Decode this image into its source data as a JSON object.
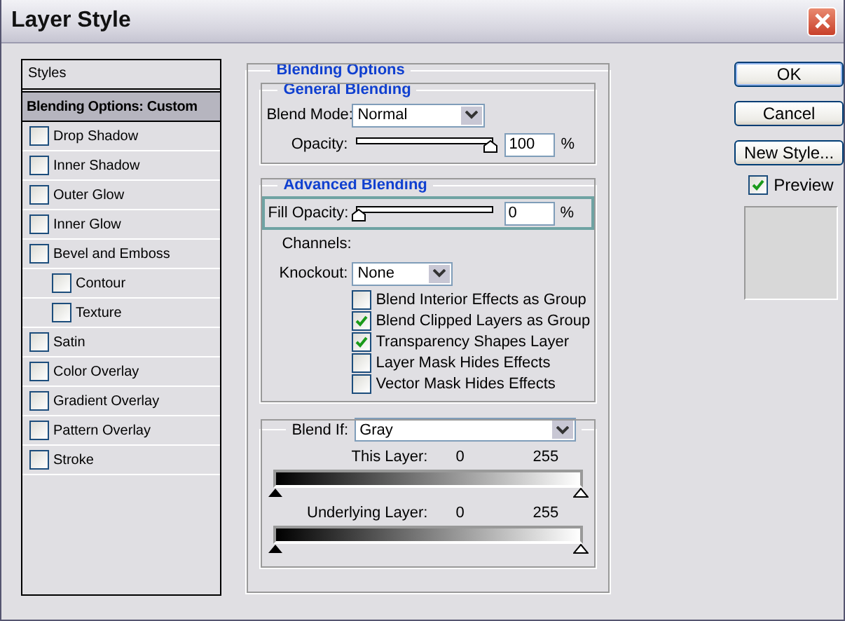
{
  "window": {
    "title": "Layer Style"
  },
  "styles_panel": {
    "header": "Styles",
    "items": [
      {
        "label": "Blending Options: Custom",
        "kind": "heading",
        "selected": true
      },
      {
        "label": "Drop Shadow",
        "kind": "check",
        "checked": false,
        "selected": false
      },
      {
        "label": "Inner Shadow",
        "kind": "check",
        "checked": false,
        "selected": false
      },
      {
        "label": "Outer Glow",
        "kind": "check",
        "checked": false,
        "selected": false
      },
      {
        "label": "Inner Glow",
        "kind": "check",
        "checked": false,
        "selected": false
      },
      {
        "label": "Bevel and Emboss",
        "kind": "check",
        "checked": false,
        "selected": false,
        "children": [
          {
            "label": "Contour",
            "kind": "check",
            "checked": false,
            "selected": false
          },
          {
            "label": "Texture",
            "kind": "check",
            "checked": false,
            "selected": false
          }
        ]
      },
      {
        "label": "Satin",
        "kind": "check",
        "checked": false,
        "selected": false
      },
      {
        "label": "Color Overlay",
        "kind": "check",
        "checked": false,
        "selected": false
      },
      {
        "label": "Gradient Overlay",
        "kind": "check",
        "checked": false,
        "selected": false
      },
      {
        "label": "Pattern Overlay",
        "kind": "check",
        "checked": false,
        "selected": false
      },
      {
        "label": "Stroke",
        "kind": "check",
        "checked": false,
        "selected": false
      }
    ]
  },
  "blending_options": {
    "title": "Blending Options",
    "general": {
      "title": "General Blending",
      "blend_mode": {
        "label": "Blend Mode:",
        "value": "Normal"
      },
      "opacity": {
        "label": "Opacity:",
        "level": 1,
        "value": "100",
        "unit": "%"
      }
    },
    "advanced": {
      "title": "Advanced Blending",
      "fill_opacity": {
        "label": "Fill Opacity:",
        "level": 0,
        "value": "0",
        "unit": "%",
        "highlighted": true
      },
      "channels_label": "Channels:",
      "knockout": {
        "label": "Knockout:",
        "value": "None"
      },
      "options": [
        {
          "label": "Blend Interior Effects as Group",
          "checked": false
        },
        {
          "label": "Blend Clipped Layers as Group",
          "checked": true
        },
        {
          "label": "Transparency Shapes Layer",
          "checked": true
        },
        {
          "label": "Layer Mask Hides Effects",
          "checked": false
        },
        {
          "label": "Vector Mask Hides Effects",
          "checked": false
        }
      ]
    },
    "blend_if": {
      "label": "Blend If:",
      "value": "Gray",
      "ramps": [
        {
          "label": "This Layer:",
          "low": "0",
          "high": "255"
        },
        {
          "label": "Underlying Layer:",
          "low": "0",
          "high": "255"
        }
      ]
    }
  },
  "buttons": [
    {
      "label": "OK",
      "default": true
    },
    {
      "label": "Cancel",
      "default": false
    },
    {
      "label": "New Style...",
      "default": false
    }
  ],
  "preview": {
    "label": "Preview",
    "checked": true
  }
}
